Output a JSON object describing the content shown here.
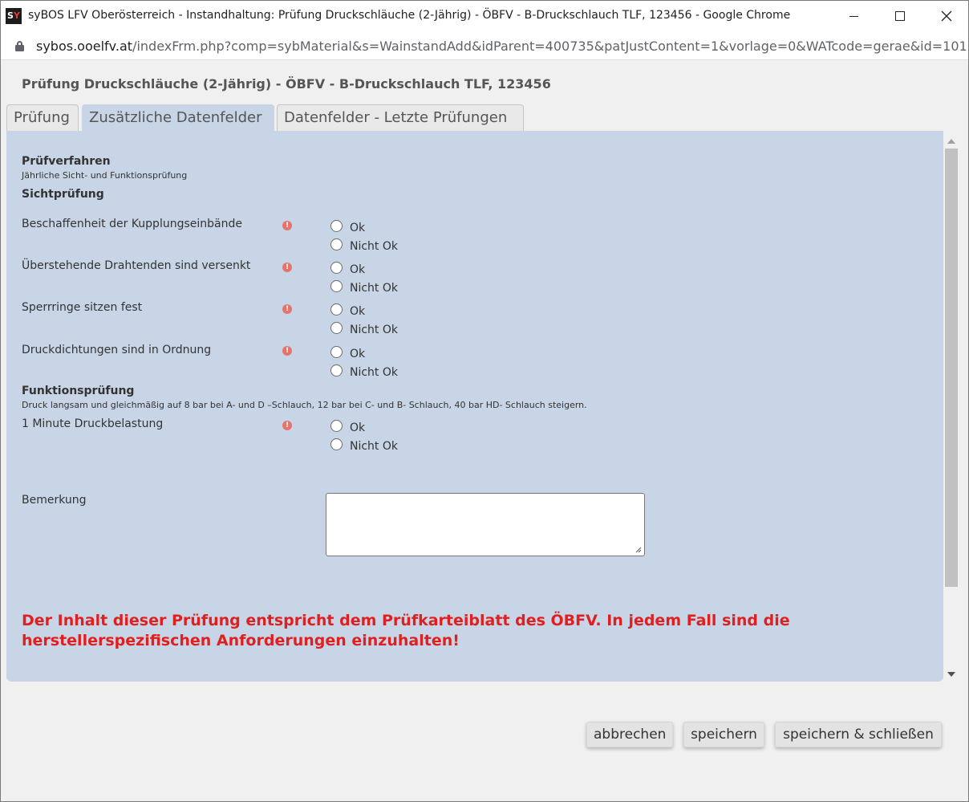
{
  "window": {
    "title": "syBOS LFV Oberösterreich - Instandhaltung: Prüfung Druckschläuche (2-Jährig) - ÖBFV - B-Druckschlauch TLF, 123456 - Google Chrome",
    "logo_text_s": "S",
    "logo_text_y": "Y"
  },
  "address": {
    "host": "sybos.ooelfv.at",
    "path": "/indexFrm.php?comp=sybMaterial&s=WainstandAdd&idParent=400735&patJustContent=1&vorlage=0&WATcode=gerae&id=101..."
  },
  "page": {
    "title": "Prüfung Druckschläuche (2-Jährig) - ÖBFV - B-Druckschlauch TLF, 123456"
  },
  "tabs": [
    {
      "label": "Prüfung",
      "active": false
    },
    {
      "label": "Zusätzliche Datenfelder",
      "active": true
    },
    {
      "label": "Datenfelder - Letzte Prüfungen",
      "active": false
    }
  ],
  "form": {
    "pruefverfahren": {
      "heading": "Prüfverfahren",
      "sub": "Jährliche Sicht- und Funktionsprüfung"
    },
    "sichtpruefung": {
      "heading": "Sichtprüfung"
    },
    "questions": [
      {
        "label": "Beschaffenheit der Kupplungseinbände",
        "ok": "Ok",
        "nok": "Nicht Ok"
      },
      {
        "label": "Überstehende Drahtenden sind versenkt",
        "ok": "Ok",
        "nok": "Nicht Ok"
      },
      {
        "label": "Sperrringe sitzen fest",
        "ok": "Ok",
        "nok": "Nicht Ok"
      },
      {
        "label": "Druckdichtungen sind in Ordnung",
        "ok": "Ok",
        "nok": "Nicht Ok"
      },
      {
        "label": "1 Minute Druckbelastung",
        "ok": "Ok",
        "nok": "Nicht Ok"
      }
    ],
    "funktionspruefung": {
      "heading": "Funktionsprüfung",
      "sub": "Druck langsam und gleichmäßig auf 8 bar bei A- und D –Schlauch, 12 bar bei C- und B- Schlauch, 40 bar HD- Schlauch steigern."
    },
    "remark_label": "Bemerkung",
    "remark_value": "",
    "notice": "Der Inhalt dieser Prüfung entspricht dem Prüfkarteiblatt des ÖBFV. In jedem Fall sind die herstellerspezifischen Anforderungen einzuhalten!"
  },
  "buttons": {
    "cancel": "abbrechen",
    "save": "speichern",
    "save_close": "speichern & schließen"
  },
  "colors": {
    "panel_bg": "#c8d5e6",
    "notice": "#e02020",
    "warn_icon": "#e8726c"
  }
}
